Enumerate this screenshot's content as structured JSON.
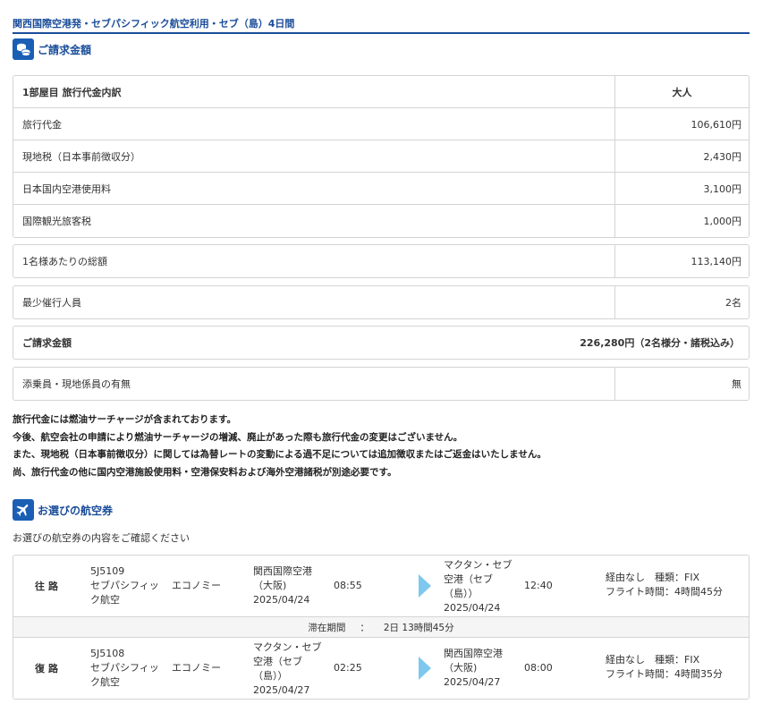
{
  "trip_title": "関西国際空港発・セブパシフィック航空利用・セブ（島）4日間",
  "billing": {
    "heading": "ご請求金額",
    "header_left": "1部屋目 旅行代金内訳",
    "header_right": "大人",
    "items": [
      {
        "label": "旅行代金",
        "value": "106,610円"
      },
      {
        "label": "現地税（日本事前徴収分）",
        "value": "2,430円"
      },
      {
        "label": "日本国内空港使用料",
        "value": "3,100円"
      },
      {
        "label": "国際観光旅客税",
        "value": "1,000円"
      }
    ],
    "per_person_label": "1名様あたりの総額",
    "per_person_value": "113,140円",
    "min_label": "最少催行人員",
    "min_value": "2名",
    "total_label": "ご請求金額",
    "total_value": "226,280円（2名様分・諸税込み）",
    "escort_label": "添乗員・現地係員の有無",
    "escort_value": "無"
  },
  "notes": [
    "旅行代金には燃油サーチャージが含まれております。",
    "今後、航空会社の申請により燃油サーチャージの増減、廃止があった際も旅行代金の変更はございません。",
    "また、現地税（日本事前徴収分）に関しては為替レートの変動による過不足については追加徴収またはご返金はいたしません。",
    "尚、旅行代金の他に国内空港施設使用料・空港保安料および海外空港諸税が別途必要です。"
  ],
  "flights": {
    "heading": "お選びの航空券",
    "subtext": "お選びの航空券の内容をご確認ください",
    "outbound": {
      "dir": "往路",
      "flight_no": "5J5109",
      "airline": [
        "セブパシフィッ",
        "ク航空"
      ],
      "class": "エコノミー",
      "dep_airport": [
        "関西国際空港",
        "（大阪)"
      ],
      "dep_date": "2025/04/24",
      "dep_time": "08:55",
      "arr_airport": [
        "マクタン・セブ",
        "空港（セブ",
        "（島））"
      ],
      "arr_date": "2025/04/24",
      "arr_time": "12:40",
      "info1": "経由なし　種類：FIX",
      "info2": "フライト時間：4時間45分"
    },
    "stay_label": "滞在期間",
    "stay_colon": "：",
    "stay_value": "2日 13時間45分",
    "return": {
      "dir": "復路",
      "flight_no": "5J5108",
      "airline": [
        "セブパシフィッ",
        "ク航空"
      ],
      "class": "エコノミー",
      "dep_airport": [
        "マクタン・セブ",
        "空港（セブ",
        "（島））"
      ],
      "dep_date": "2025/04/27",
      "dep_time": "02:25",
      "arr_airport": [
        "関西国際空港",
        "（大阪)"
      ],
      "arr_date": "2025/04/27",
      "arr_time": "08:00",
      "info1": "経由なし　種類：FIX",
      "info2": "フライト時間：4時間35分"
    }
  },
  "colors": {
    "brand": "#1a4d99",
    "icon_bg": "#1a5fb4",
    "arrow": "#7ec8ef",
    "border": "#d4d4d4"
  }
}
